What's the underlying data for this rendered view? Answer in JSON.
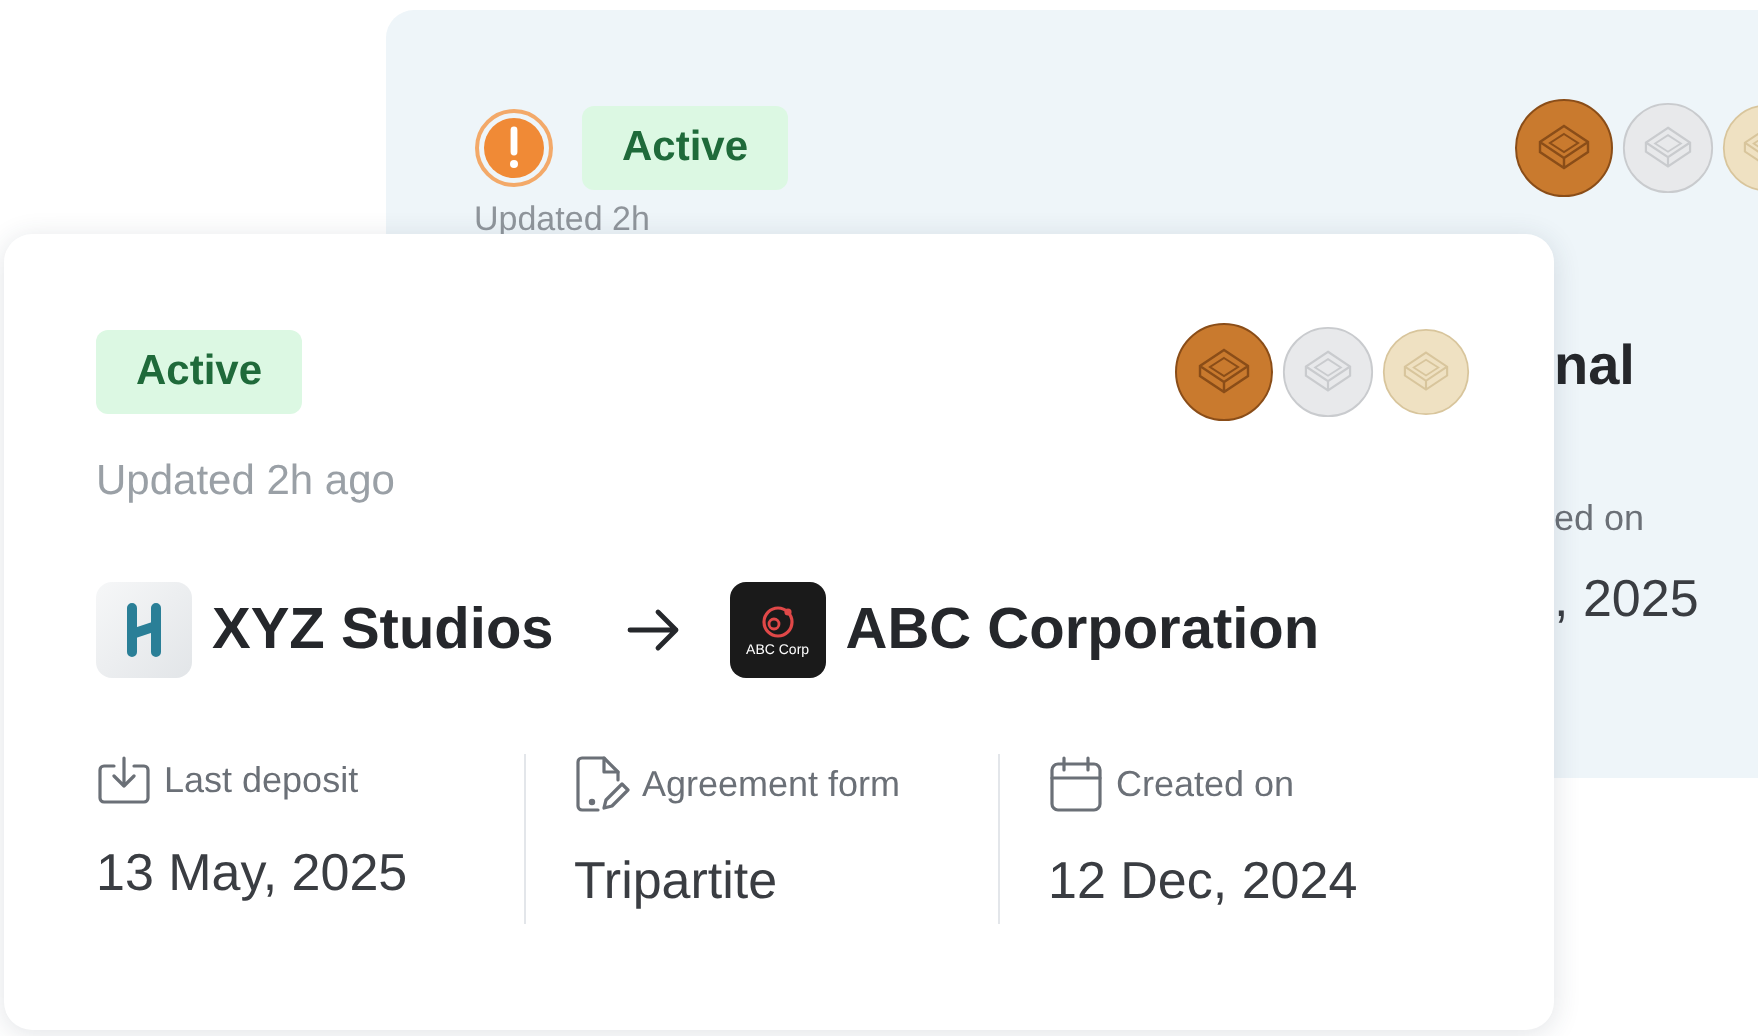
{
  "back_card": {
    "status_badge": "Active",
    "updated": "Updated 2h",
    "title_fragment": "nal",
    "date_label_fragment": "ed on",
    "date_value_fragment": ", 2025"
  },
  "card": {
    "status_badge": "Active",
    "updated": "Updated 2h ago",
    "sender": {
      "name": "XYZ Studios"
    },
    "recipient": {
      "name": "ABC Corporation",
      "logo_text": "ABC Corp"
    },
    "details": [
      {
        "kind": "deposit",
        "label": "Last deposit",
        "value": "13 May, 2025"
      },
      {
        "kind": "agreement",
        "label": "Agreement form",
        "value": "Tripartite"
      },
      {
        "kind": "calendar",
        "label": "Created on",
        "value": "12 Dec, 2024"
      }
    ]
  }
}
